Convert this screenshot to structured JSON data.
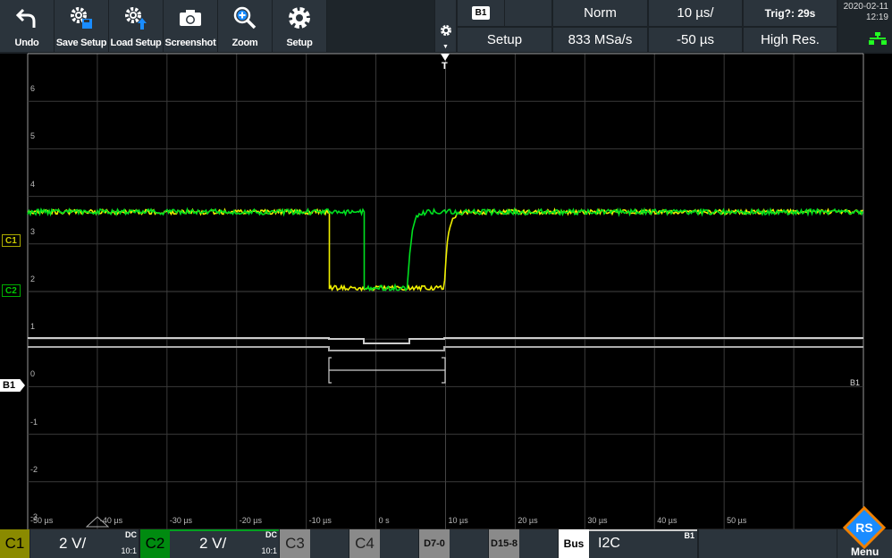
{
  "toolbar": {
    "buttons": [
      {
        "label": "Undo",
        "icon": "undo-icon"
      },
      {
        "label": "Save Setup",
        "icon": "save-setup-icon"
      },
      {
        "label": "Load Setup",
        "icon": "load-setup-icon"
      },
      {
        "label": "Screenshot",
        "icon": "camera-icon"
      },
      {
        "label": "Zoom",
        "icon": "zoom-icon"
      },
      {
        "label": "Setup",
        "icon": "gear-icon"
      }
    ]
  },
  "status": {
    "bus_badge": "B1",
    "trigger_mode": "Norm",
    "timebase": "10 µs/",
    "trigger_status": "Trig?: 29s",
    "setup_label": "Setup",
    "sample_rate": "833 MSa/s",
    "horizontal_position": "-50 µs",
    "acquisition_mode": "High Res.",
    "date": "2020-02-11",
    "time": "12:19"
  },
  "plot": {
    "trigger_marker": "T",
    "y_labels": [
      "6",
      "5",
      "4",
      "3",
      "2",
      "1",
      "0",
      "-1",
      "-2",
      "-3"
    ],
    "x_labels": [
      "-50 µs",
      "-40 µs",
      "-30 µs",
      "-20 µs",
      "-10 µs",
      "0 s",
      "10 µs",
      "20 µs",
      "30 µs",
      "40 µs",
      "50 µs"
    ],
    "markers": {
      "c1": "C1",
      "c2": "C2",
      "b1": "B1"
    },
    "bus_label": "B1",
    "colors": {
      "c1": "#f0f000",
      "c2": "#00e020",
      "bus": "#ffffff"
    }
  },
  "bottom": {
    "c1": {
      "label": "C1",
      "scale": "2 V/",
      "coupling": "DC",
      "probe": "10:1"
    },
    "c2": {
      "label": "C2",
      "scale": "2 V/",
      "coupling": "DC",
      "probe": "10:1"
    },
    "c3": {
      "label": "C3"
    },
    "c4": {
      "label": "C4"
    },
    "d70": {
      "label": "D7-0"
    },
    "d158": {
      "label": "D15-8"
    },
    "bus": {
      "label": "Bus",
      "protocol": "I2C",
      "id": "B1"
    },
    "menu": {
      "label": "Menu"
    }
  }
}
